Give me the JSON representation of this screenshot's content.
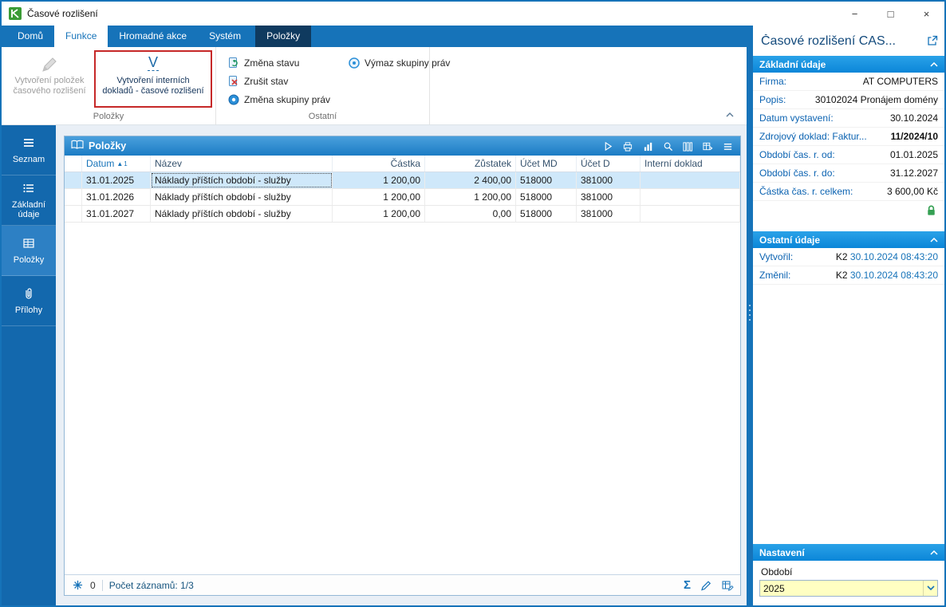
{
  "window": {
    "title": "Časové rozlišení",
    "controls": {
      "minimize": "−",
      "maximize": "□",
      "close": "×"
    }
  },
  "ribbon": {
    "tabs": [
      {
        "label": "Domů"
      },
      {
        "label": "Funkce"
      },
      {
        "label": "Hromadné akce"
      },
      {
        "label": "Systém"
      },
      {
        "label": "Položky"
      }
    ],
    "groups": {
      "polozky": {
        "label": "Položky",
        "create_items_button": {
          "line1": "Vytvoření položek",
          "line2": "časového rozlišení"
        },
        "create_docs_button": {
          "letter": "V",
          "line1": "Vytvoření interních",
          "line2": "dokladů - časové rozlišení"
        }
      },
      "ostatni": {
        "label": "Ostatní",
        "zmena_stavu": "Změna stavu",
        "zrusit_stav": "Zrušit stav",
        "zmena_skupiny_prav": "Změna skupiny práv",
        "vymaz_skupiny_prav": "Výmaz skupiny práv"
      }
    }
  },
  "sidebar": {
    "items": [
      {
        "label": "Seznam"
      },
      {
        "label": "Základní údaje"
      },
      {
        "label": "Položky"
      },
      {
        "label": "Přílohy"
      }
    ]
  },
  "grid": {
    "panel_title": "Položky",
    "columns": {
      "datum": "Datum",
      "nazev": "Název",
      "castka": "Částka",
      "zustatek": "Zůstatek",
      "ucet_md": "Účet MD",
      "ucet_d": "Účet D",
      "interni_doklad": "Interní doklad"
    },
    "sort": {
      "arrow": "▲",
      "order": "1"
    },
    "rows": [
      {
        "datum": "31.01.2025",
        "nazev": "Náklady příštích období - služby",
        "castka": "1 200,00",
        "zustatek": "2 400,00",
        "ucet_md": "518000",
        "ucet_d": "381000",
        "interni_doklad": ""
      },
      {
        "datum": "31.01.2026",
        "nazev": "Náklady příštích období - služby",
        "castka": "1 200,00",
        "zustatek": "1 200,00",
        "ucet_md": "518000",
        "ucet_d": "381000",
        "interni_doklad": ""
      },
      {
        "datum": "31.01.2027",
        "nazev": "Náklady příštích období - služby",
        "castka": "1 200,00",
        "zustatek": "0,00",
        "ucet_md": "518000",
        "ucet_d": "381000",
        "interni_doklad": ""
      }
    ],
    "status": {
      "flag_count": "0",
      "record_count": "Počet záznamů: 1/3",
      "sum_icon": "Σ"
    }
  },
  "detail": {
    "title": "Časové rozlišení CAS...",
    "basic": {
      "title": "Základní údaje",
      "fields": [
        {
          "label": "Firma:",
          "value": "AT COMPUTERS"
        },
        {
          "label": "Popis:",
          "value": "30102024 Pronájem domény"
        },
        {
          "label": "Datum vystavení:",
          "value": "30.10.2024"
        },
        {
          "label": "Zdrojový doklad: Faktur...",
          "value": "11/2024/10"
        },
        {
          "label": "Období čas. r. od:",
          "value": "01.01.2025"
        },
        {
          "label": "Období čas. r. do:",
          "value": "31.12.2027"
        },
        {
          "label": "Částka čas. r. celkem:",
          "value": "3 600,00 Kč"
        }
      ]
    },
    "other": {
      "title": "Ostatní údaje",
      "fields": [
        {
          "label": "Vytvořil:",
          "user": "K2",
          "timestamp": "30.10.2024 08:43:20"
        },
        {
          "label": "Změnil:",
          "user": "K2",
          "timestamp": "30.10.2024 08:43:20"
        }
      ]
    },
    "settings": {
      "title": "Nastavení",
      "period_label": "Období",
      "period_value": "2025"
    }
  }
}
